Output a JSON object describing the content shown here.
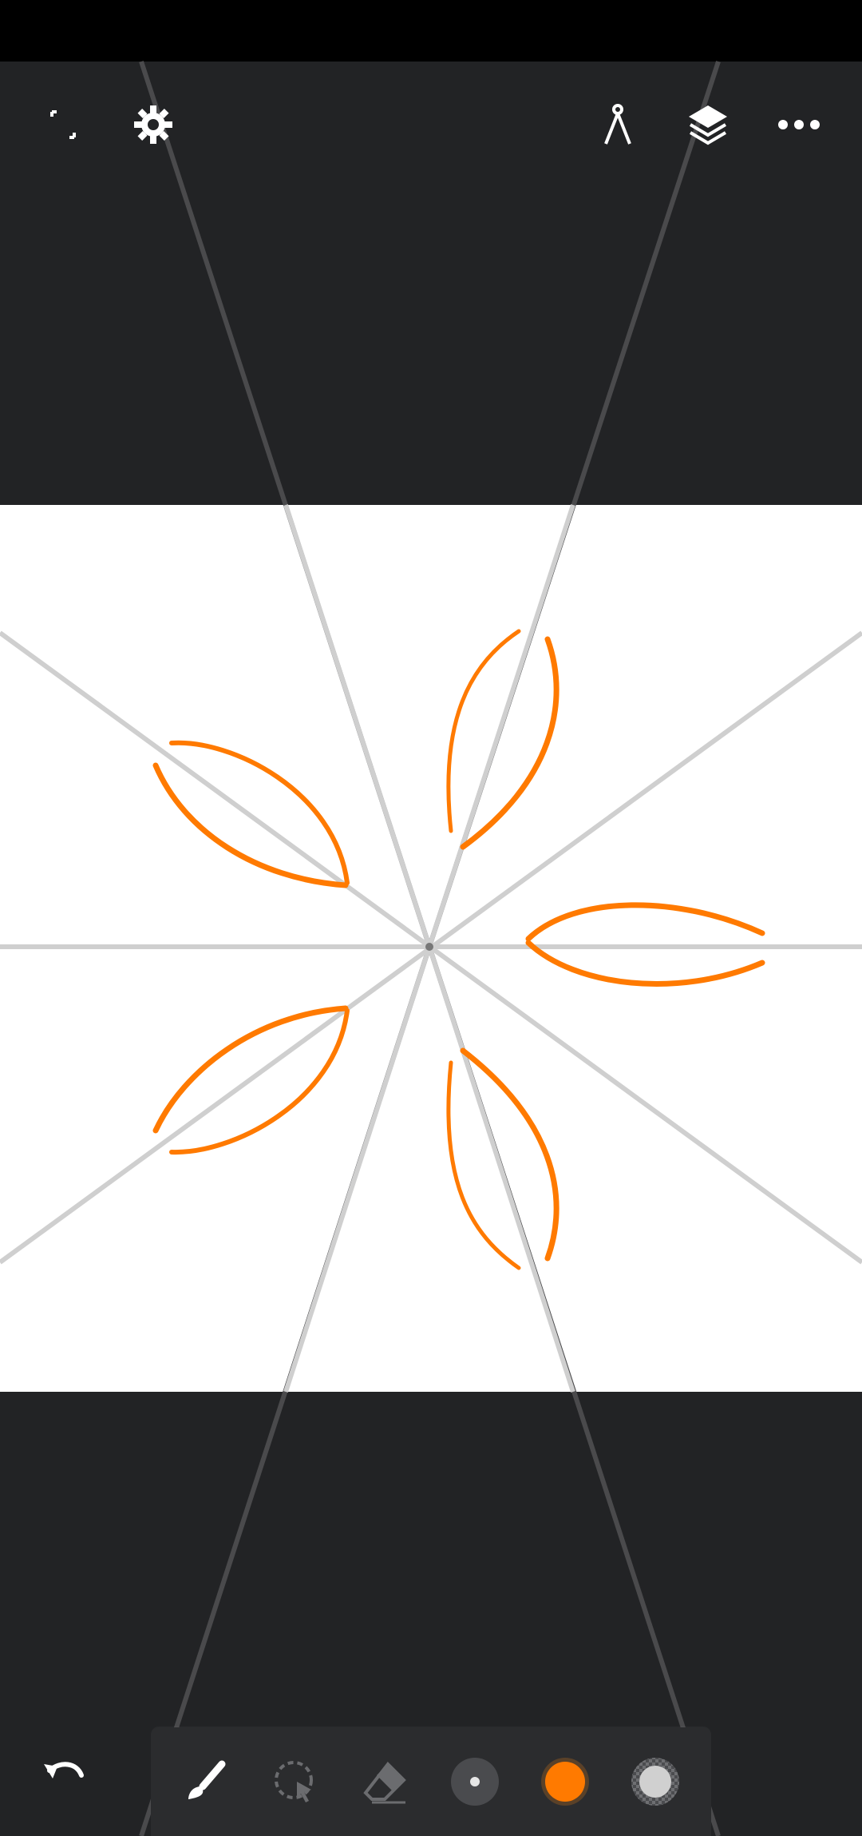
{
  "app": {
    "name": "",
    "accent": "#ff7a00"
  },
  "top_bar": {
    "left": [
      {
        "icon": "fullscreen-icon"
      },
      {
        "icon": "gear-icon"
      }
    ],
    "right": [
      {
        "icon": "compass-icon"
      },
      {
        "icon": "layers-icon"
      },
      {
        "icon": "more-icon"
      }
    ]
  },
  "canvas": {
    "background": "#ffffff",
    "guide_color": "#cccccc",
    "symmetry_axes": 5,
    "stroke_color": "#ff7a00"
  },
  "toolbar": {
    "undo": {
      "icon": "undo-icon"
    },
    "tools": [
      {
        "icon": "brush-icon",
        "active": true
      },
      {
        "icon": "lasso-select-icon",
        "active": false
      },
      {
        "icon": "eraser-icon",
        "active": false
      },
      {
        "icon": "brush-size-icon",
        "active": false
      },
      {
        "icon": "color-swatch-icon",
        "color": "#ff7a00",
        "active": false
      },
      {
        "icon": "opacity-icon",
        "active": false
      }
    ]
  }
}
